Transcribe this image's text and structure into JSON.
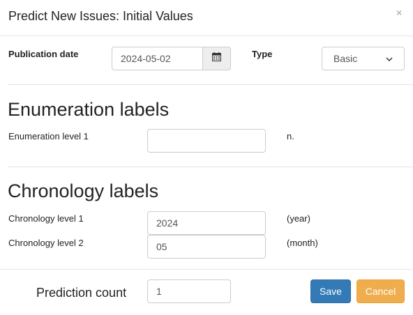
{
  "modal": {
    "title": "Predict New Issues: Initial Values",
    "close_symbol": "×"
  },
  "publication": {
    "label": "Publication date",
    "value": "2024-05-02",
    "calendar_icon": "calendar-icon"
  },
  "type": {
    "label": "Type",
    "selected": "Basic"
  },
  "enumeration": {
    "heading": "Enumeration labels",
    "levels": [
      {
        "label": "Enumeration level 1",
        "value": "",
        "suffix": "n."
      }
    ]
  },
  "chronology": {
    "heading": "Chronology labels",
    "levels": [
      {
        "label": "Chronology level 1",
        "value": "2024",
        "suffix": "(year)"
      },
      {
        "label": "Chronology level 2",
        "value": "05",
        "suffix": "(month)"
      }
    ]
  },
  "footer": {
    "prediction_label": "Prediction count",
    "prediction_value": "1",
    "save_label": "Save",
    "cancel_label": "Cancel"
  },
  "colors": {
    "save": "#337ab7",
    "cancel": "#f0ad4e"
  }
}
